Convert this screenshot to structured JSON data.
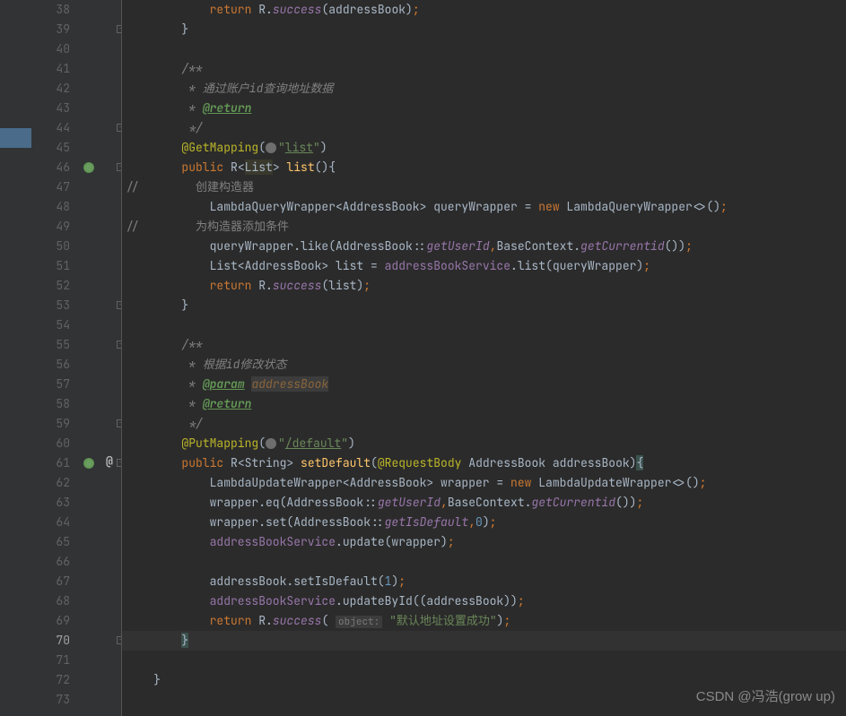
{
  "lines": {
    "38": {
      "num": "38",
      "indent": "            ",
      "tokens": [
        [
          "kw",
          "return"
        ],
        [
          "ident",
          " R."
        ],
        [
          "static-m",
          "success"
        ],
        [
          "ident",
          "(addressBook)"
        ],
        [
          "kw",
          ";"
        ]
      ]
    },
    "39": {
      "num": "39",
      "indent": "        ",
      "tokens": [
        [
          "ident",
          "}"
        ]
      ]
    },
    "40": {
      "num": "40",
      "indent": "",
      "tokens": []
    },
    "41": {
      "num": "41",
      "indent": "        ",
      "tokens": [
        [
          "comment",
          "/**"
        ]
      ]
    },
    "42": {
      "num": "42",
      "indent": "         ",
      "tokens": [
        [
          "comment",
          "* 通过账户id查询地址数据"
        ]
      ]
    },
    "43": {
      "num": "43",
      "indent": "         ",
      "tokens": [
        [
          "comment",
          "* "
        ],
        [
          "doc-tag",
          "@return"
        ]
      ]
    },
    "44": {
      "num": "44",
      "indent": "         ",
      "tokens": [
        [
          "comment",
          "*/"
        ]
      ]
    },
    "45": {
      "num": "45",
      "indent": "        ",
      "tokens": [
        [
          "anno",
          "@GetMapping"
        ],
        [
          "ident",
          "("
        ],
        [
          "globe",
          ""
        ],
        [
          "str",
          "\""
        ],
        [
          "str-u",
          "list"
        ],
        [
          "str",
          "\""
        ],
        [
          "ident",
          ")"
        ]
      ]
    },
    "46": {
      "num": "46",
      "indent": "        ",
      "tokens": [
        [
          "kw",
          "public"
        ],
        [
          "ident",
          " R<"
        ],
        [
          "hl-bg",
          "List"
        ],
        [
          "ident",
          "> "
        ],
        [
          "method",
          "list"
        ],
        [
          "ident",
          "(){"
        ]
      ]
    },
    "47": {
      "num": "47",
      "indent": "",
      "tokens": [
        [
          "comment-slash",
          "//        创建构造器"
        ]
      ]
    },
    "48": {
      "num": "48",
      "indent": "            ",
      "tokens": [
        [
          "ident",
          "LambdaQueryWrapper<AddressBook> queryWrapper = "
        ],
        [
          "kw",
          "new"
        ],
        [
          "ident",
          " LambdaQueryWrapper<>()"
        ],
        [
          "kw",
          ";"
        ]
      ]
    },
    "49": {
      "num": "49",
      "indent": "",
      "tokens": [
        [
          "comment-slash",
          "//        为构造器添加条件"
        ]
      ]
    },
    "50": {
      "num": "50",
      "indent": "            ",
      "tokens": [
        [
          "ident",
          "queryWrapper.like(AddressBook::"
        ],
        [
          "static-m",
          "getUserId"
        ],
        [
          "kw",
          ","
        ],
        [
          "ident",
          "BaseContext."
        ],
        [
          "static-m",
          "getCurrentid"
        ],
        [
          "ident",
          "())"
        ],
        [
          "kw",
          ";"
        ]
      ]
    },
    "51": {
      "num": "51",
      "indent": "            ",
      "tokens": [
        [
          "ident",
          "List<AddressBook> list = "
        ],
        [
          "field",
          "addressBookService"
        ],
        [
          "ident",
          ".list(queryWrapper)"
        ],
        [
          "kw",
          ";"
        ]
      ]
    },
    "52": {
      "num": "52",
      "indent": "            ",
      "tokens": [
        [
          "kw",
          "return"
        ],
        [
          "ident",
          " R."
        ],
        [
          "static-m",
          "success"
        ],
        [
          "ident",
          "(list)"
        ],
        [
          "kw",
          ";"
        ]
      ]
    },
    "53": {
      "num": "53",
      "indent": "        ",
      "tokens": [
        [
          "ident",
          "}"
        ]
      ]
    },
    "54": {
      "num": "54",
      "indent": "",
      "tokens": []
    },
    "55": {
      "num": "55",
      "indent": "        ",
      "tokens": [
        [
          "comment",
          "/**"
        ]
      ]
    },
    "56": {
      "num": "56",
      "indent": "         ",
      "tokens": [
        [
          "comment",
          "* 根据id修改状态"
        ]
      ]
    },
    "57": {
      "num": "57",
      "indent": "         ",
      "tokens": [
        [
          "comment",
          "* "
        ],
        [
          "doc-tag",
          "@param"
        ],
        [
          "comment",
          " "
        ],
        [
          "doc-param",
          "addressBook"
        ]
      ]
    },
    "58": {
      "num": "58",
      "indent": "         ",
      "tokens": [
        [
          "comment",
          "* "
        ],
        [
          "doc-tag",
          "@return"
        ]
      ]
    },
    "59": {
      "num": "59",
      "indent": "         ",
      "tokens": [
        [
          "comment",
          "*/"
        ]
      ]
    },
    "60": {
      "num": "60",
      "indent": "        ",
      "tokens": [
        [
          "anno",
          "@PutMapping"
        ],
        [
          "ident",
          "("
        ],
        [
          "globe",
          ""
        ],
        [
          "str",
          "\""
        ],
        [
          "str-u",
          "/default"
        ],
        [
          "str",
          "\""
        ],
        [
          "ident",
          ")"
        ]
      ]
    },
    "61": {
      "num": "61",
      "indent": "        ",
      "tokens": [
        [
          "kw",
          "public"
        ],
        [
          "ident",
          " R<String> "
        ],
        [
          "method",
          "setDefault"
        ],
        [
          "ident",
          "("
        ],
        [
          "anno",
          "@RequestBody"
        ],
        [
          "ident",
          " AddressBook addressBook)"
        ],
        [
          "paren-hl",
          "{"
        ]
      ]
    },
    "62": {
      "num": "62",
      "indent": "            ",
      "tokens": [
        [
          "ident",
          "LambdaUpdateWrapper<AddressBook> wrapper = "
        ],
        [
          "kw",
          "new"
        ],
        [
          "ident",
          " LambdaUpdateWrapper<>()"
        ],
        [
          "kw",
          ";"
        ]
      ]
    },
    "63": {
      "num": "63",
      "indent": "            ",
      "tokens": [
        [
          "ident",
          "wrapper.eq(AddressBook::"
        ],
        [
          "static-m",
          "getUserId"
        ],
        [
          "kw",
          ","
        ],
        [
          "ident",
          "BaseContext."
        ],
        [
          "static-m",
          "getCurrentid"
        ],
        [
          "ident",
          "())"
        ],
        [
          "kw",
          ";"
        ]
      ]
    },
    "64": {
      "num": "64",
      "indent": "            ",
      "tokens": [
        [
          "ident",
          "wrapper.set(AddressBook::"
        ],
        [
          "static-m",
          "getIsDefault"
        ],
        [
          "kw",
          ","
        ],
        [
          "num",
          "0"
        ],
        [
          "ident",
          ")"
        ],
        [
          "kw",
          ";"
        ]
      ]
    },
    "65": {
      "num": "65",
      "indent": "            ",
      "tokens": [
        [
          "field",
          "addressBookService"
        ],
        [
          "ident",
          ".update(wrapper)"
        ],
        [
          "kw",
          ";"
        ]
      ]
    },
    "66": {
      "num": "66",
      "indent": "",
      "tokens": []
    },
    "67": {
      "num": "67",
      "indent": "            ",
      "tokens": [
        [
          "ident",
          "addressBook.setIsDefault("
        ],
        [
          "num",
          "1"
        ],
        [
          "ident",
          ")"
        ],
        [
          "kw",
          ";"
        ]
      ]
    },
    "68": {
      "num": "68",
      "indent": "            ",
      "tokens": [
        [
          "field",
          "addressBookService"
        ],
        [
          "ident",
          ".updateById((addressBook))"
        ],
        [
          "kw",
          ";"
        ]
      ]
    },
    "69": {
      "num": "69",
      "indent": "            ",
      "tokens": [
        [
          "kw",
          "return"
        ],
        [
          "ident",
          " R."
        ],
        [
          "static-m",
          "success"
        ],
        [
          "ident",
          "( "
        ],
        [
          "hint",
          "object:"
        ],
        [
          "ident",
          " "
        ],
        [
          "str",
          "\"默认地址设置成功\""
        ],
        [
          "ident",
          ")"
        ],
        [
          "kw",
          ";"
        ]
      ]
    },
    "70": {
      "num": "70",
      "indent": "        ",
      "tokens": [
        [
          "paren-hl",
          "}"
        ]
      ]
    },
    "71": {
      "num": "71",
      "indent": "",
      "tokens": []
    },
    "72": {
      "num": "72",
      "indent": "    ",
      "tokens": [
        [
          "ident",
          "}"
        ]
      ]
    },
    "73": {
      "num": "73",
      "indent": "",
      "tokens": []
    }
  },
  "current_line": "70",
  "watermark": "CSDN @冯浩(grow up)",
  "markers": {
    "endpoint_lines": [
      "46",
      "61"
    ],
    "at_lines": [
      "61"
    ],
    "fold_open": [
      "39",
      "44",
      "53",
      "59",
      "70"
    ],
    "fold_close": [
      "46",
      "55",
      "61"
    ]
  }
}
